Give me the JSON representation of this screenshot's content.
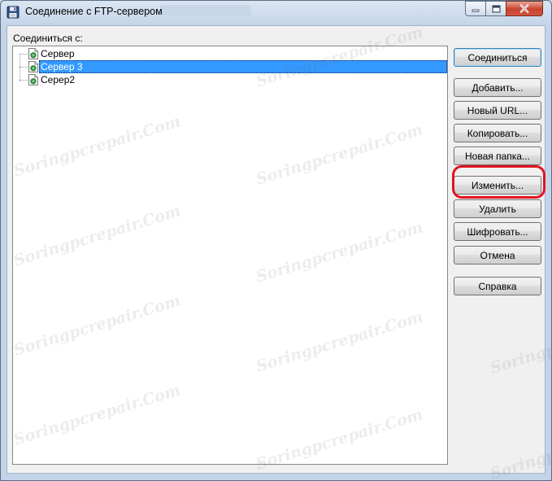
{
  "window": {
    "title": "Соединение с FTP-сервером"
  },
  "label": "Соединиться с:",
  "tree": [
    {
      "label": "Сервер",
      "selected": false
    },
    {
      "label": "Сервер 3",
      "selected": true
    },
    {
      "label": "Серер2",
      "selected": false
    }
  ],
  "buttons": {
    "connect": "Соединиться",
    "add": "Добавить...",
    "new_url": "Новый URL...",
    "copy": "Копировать...",
    "new_folder": "Новая папка...",
    "edit": "Изменить...",
    "delete": "Удалить",
    "encrypt": "Шифровать...",
    "cancel": "Отмена",
    "help": "Справка"
  },
  "watermark": "Soringpcrepair.Com",
  "colors": {
    "selection": "#3399ff",
    "highlight_ring": "#e0141e",
    "close_button": "#c7432e"
  },
  "icons": {
    "title": "floppy-disk-icon",
    "node": "ftp-server-icon"
  }
}
